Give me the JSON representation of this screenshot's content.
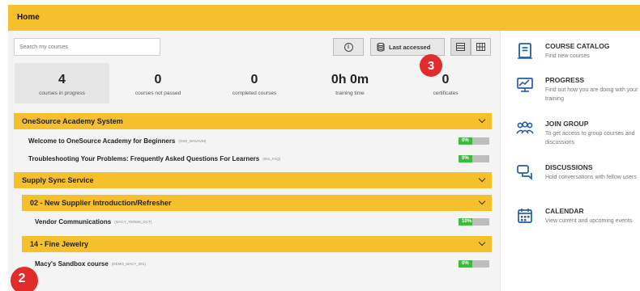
{
  "header": {
    "title": "Home"
  },
  "search": {
    "placeholder": "Search my courses"
  },
  "toolbar": {
    "info_symbol": "i",
    "sort_label": "Last accessed"
  },
  "annotations": {
    "badge_3": "3",
    "badge_2": "2"
  },
  "stats": [
    {
      "value": "4",
      "label": "courses in progress"
    },
    {
      "value": "0",
      "label": "courses not passed"
    },
    {
      "value": "0",
      "label": "completed courses"
    },
    {
      "value": "0h 0m",
      "label": "training time"
    },
    {
      "value": "0",
      "label": "certificates"
    }
  ],
  "sections": {
    "onesource": {
      "title": "OneSource Academy System",
      "courses": [
        {
          "name": "Welcome to OneSource Academy for Beginners",
          "code": "(OSE_WAVAVM)",
          "progress_text": "0%",
          "progress": 0
        },
        {
          "name": "Troubleshooting Your Problems: Frequently Asked Questions For Learners",
          "code": "(001_FAQ)",
          "progress_text": "0%",
          "progress": 0
        }
      ]
    },
    "supply_sync": {
      "title": "Supply Sync Service",
      "subsections": [
        {
          "title": "02 - New Supplier Introduction/Refresher",
          "courses": [
            {
              "name": "Vendor Communications",
              "code": "(MACY_TERMS_DCT)",
              "progress_text": "10%",
              "progress": 10
            }
          ]
        },
        {
          "title": "14 - Fine Jewelry",
          "courses": [
            {
              "name": "Macy's Sandbox course",
              "code": "(DEMO_MACY_001)",
              "progress_text": "0%",
              "progress": 0
            }
          ]
        }
      ]
    }
  },
  "sidebar": [
    {
      "title": "COURSE CATALOG",
      "desc": "Find new courses",
      "icon": "catalog-icon"
    },
    {
      "title": "PROGRESS",
      "desc": "Find out how you are doing with your training",
      "icon": "progress-icon"
    },
    {
      "title": "JOIN GROUP",
      "desc": "To get access to group courses and discussions",
      "icon": "group-icon"
    },
    {
      "title": "DISCUSSIONS",
      "desc": "Hold conversations with fellow users",
      "icon": "discussions-icon"
    },
    {
      "title": "CALENDAR",
      "desc": "View current and upcoming events",
      "icon": "calendar-icon"
    }
  ],
  "colors": {
    "accent": "#f6c02c",
    "badge": "#e22b2b",
    "progress": "#3dbb3d",
    "icon_blue": "#1f5fa8"
  }
}
